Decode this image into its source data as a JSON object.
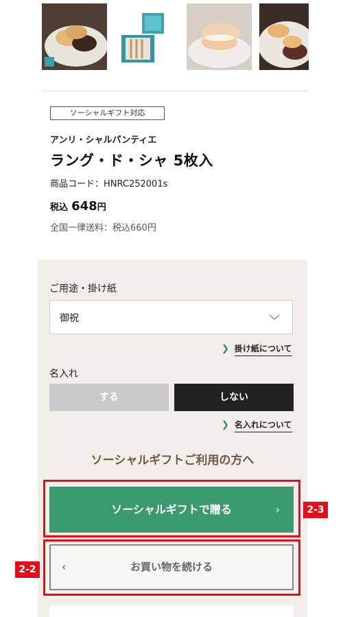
{
  "thumbnails": [
    {
      "name": "cookies-on-plate"
    },
    {
      "name": "gift-box"
    },
    {
      "name": "sandwich-cookie-on-plate"
    },
    {
      "name": "cookies-close-up"
    }
  ],
  "product": {
    "badge": "ソーシャルギフト対応",
    "brand": "アンリ・シャルパンティエ",
    "name": "ラング・ド・シャ 5枚入",
    "code": "商品コード：HNRC252001s",
    "tax_label": "税込",
    "price": "648",
    "yen": "円",
    "shipping": "全国一律送料：税込660円"
  },
  "options": {
    "purpose_label": "ご用途・掛け紙",
    "purpose_value": "御祝",
    "purpose_link": "掛け紙について",
    "name_label": "名入れ",
    "name_yes": "する",
    "name_no": "しない",
    "name_link": "名入れについて"
  },
  "social": {
    "heading": "ソーシャルギフトご利用の方へ",
    "gift_button": "ソーシャルギフトで贈る",
    "continue_button": "お買い物を続ける"
  },
  "annotations": {
    "tag_gift": "2-3",
    "tag_continue": "2-2",
    "color": "#e10f1a"
  },
  "colors": {
    "accent_green": "#3a9a6e",
    "panel_bg": "#f2efea",
    "heading_brown": "#6b5a48"
  }
}
